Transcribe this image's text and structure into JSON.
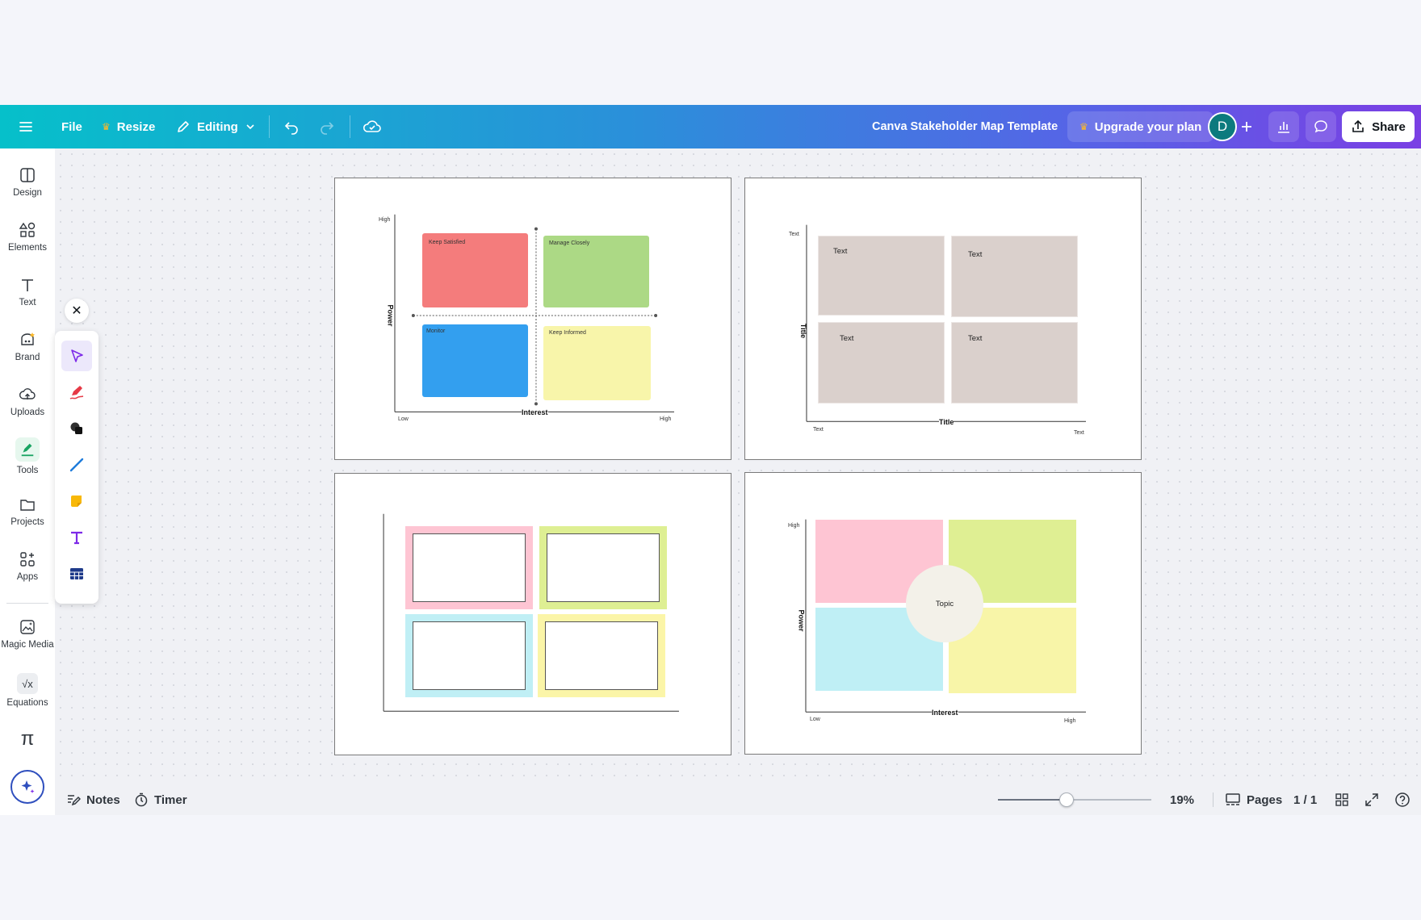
{
  "topbar": {
    "file": "File",
    "resize": "Resize",
    "editing": "Editing",
    "doc_title": "Canva Stakeholder Map Template",
    "upgrade": "Upgrade your plan",
    "avatar": "D",
    "share": "Share"
  },
  "sidebar": {
    "items": [
      {
        "label": "Design",
        "icon": "design-icon"
      },
      {
        "label": "Elements",
        "icon": "elements-icon"
      },
      {
        "label": "Text",
        "icon": "text-icon"
      },
      {
        "label": "Brand",
        "icon": "brand-icon"
      },
      {
        "label": "Uploads",
        "icon": "uploads-icon"
      },
      {
        "label": "Tools",
        "icon": "tools-icon"
      },
      {
        "label": "Projects",
        "icon": "projects-icon"
      },
      {
        "label": "Apps",
        "icon": "apps-icon"
      },
      {
        "label": "Magic Media",
        "icon": "magic-media-icon"
      },
      {
        "label": "Equations",
        "icon": "equations-icon"
      }
    ]
  },
  "tools": [
    "select-tool",
    "draw-tool",
    "shapes-tool",
    "line-tool",
    "sticky-note-tool",
    "text-tool",
    "table-tool"
  ],
  "pages": {
    "p1": {
      "high_y": "High",
      "power": "Power",
      "low_x": "Low",
      "interest": "Interest",
      "high_x": "High",
      "q": [
        "Keep Satisfied",
        "Manage Closely",
        "Monitor",
        "Keep Informed"
      ],
      "colors": [
        "#f47c7c",
        "#acd985",
        "#339fef",
        "#f8f5aa"
      ]
    },
    "p2": {
      "text_y": "Text",
      "title_y": "Title",
      "title_x": "Title",
      "text_x_left": "Text",
      "text_x_right": "Text",
      "q": [
        "Text",
        "Text",
        "Text",
        "Text"
      ],
      "color": "#dad0cc"
    },
    "p3": {
      "colors": [
        "#fec5d3",
        "#deef93",
        "#c0eff5",
        "#fbf5a8"
      ]
    },
    "p4": {
      "high_y": "High",
      "power": "Power",
      "interest": "Interest",
      "low_x": "Low",
      "high_x": "High",
      "topic": "Topic",
      "colors": [
        "#fec5d3",
        "#dfef93",
        "#bfeff5",
        "#f8f5a8",
        "#f3f1e9"
      ]
    }
  },
  "bottombar": {
    "notes": "Notes",
    "timer": "Timer",
    "zoom": "19%",
    "zoom_level": 0.19,
    "pages": "Pages",
    "page_count": "1 / 1"
  }
}
